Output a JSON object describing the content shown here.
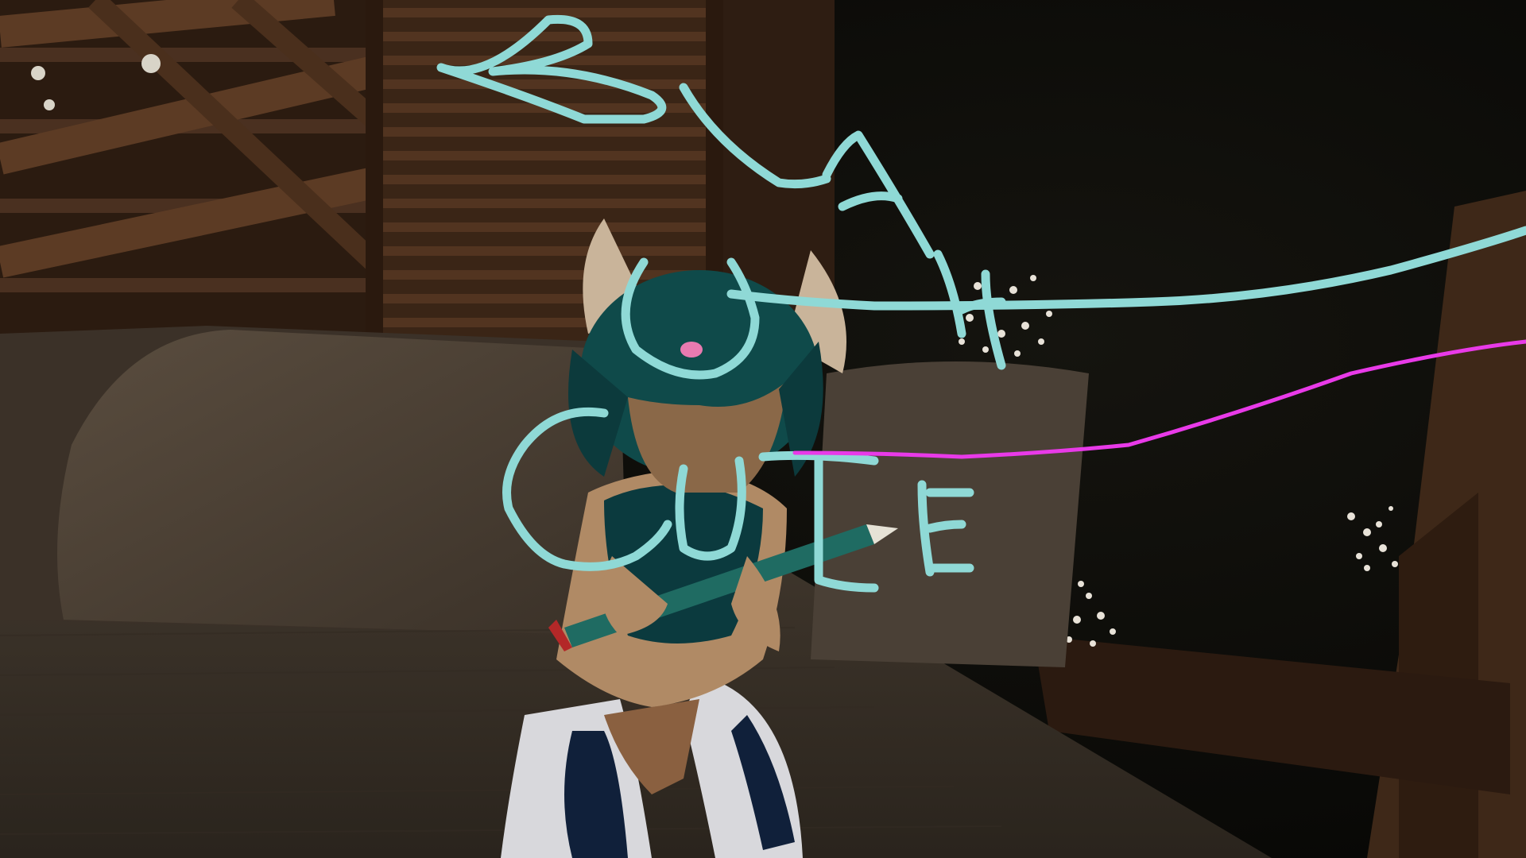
{
  "scene": {
    "handwriting_lines": [
      "BLAH",
      "U",
      "CUTE"
    ],
    "colors": {
      "ink_cyan": "#8fd9d6",
      "pen_laser_magenta": "#e83ae8",
      "wood_dark": "#3a2516",
      "wood_mid": "#5a3a22",
      "bed_fabric": "#4a3f33",
      "night_bg": "#0d0d09",
      "flowers": "#e8e2d8",
      "avatar_hair": "#0f4a4a",
      "avatar_fur": "#c9b49a"
    },
    "icons": [
      "drawing-pen-icon"
    ]
  }
}
